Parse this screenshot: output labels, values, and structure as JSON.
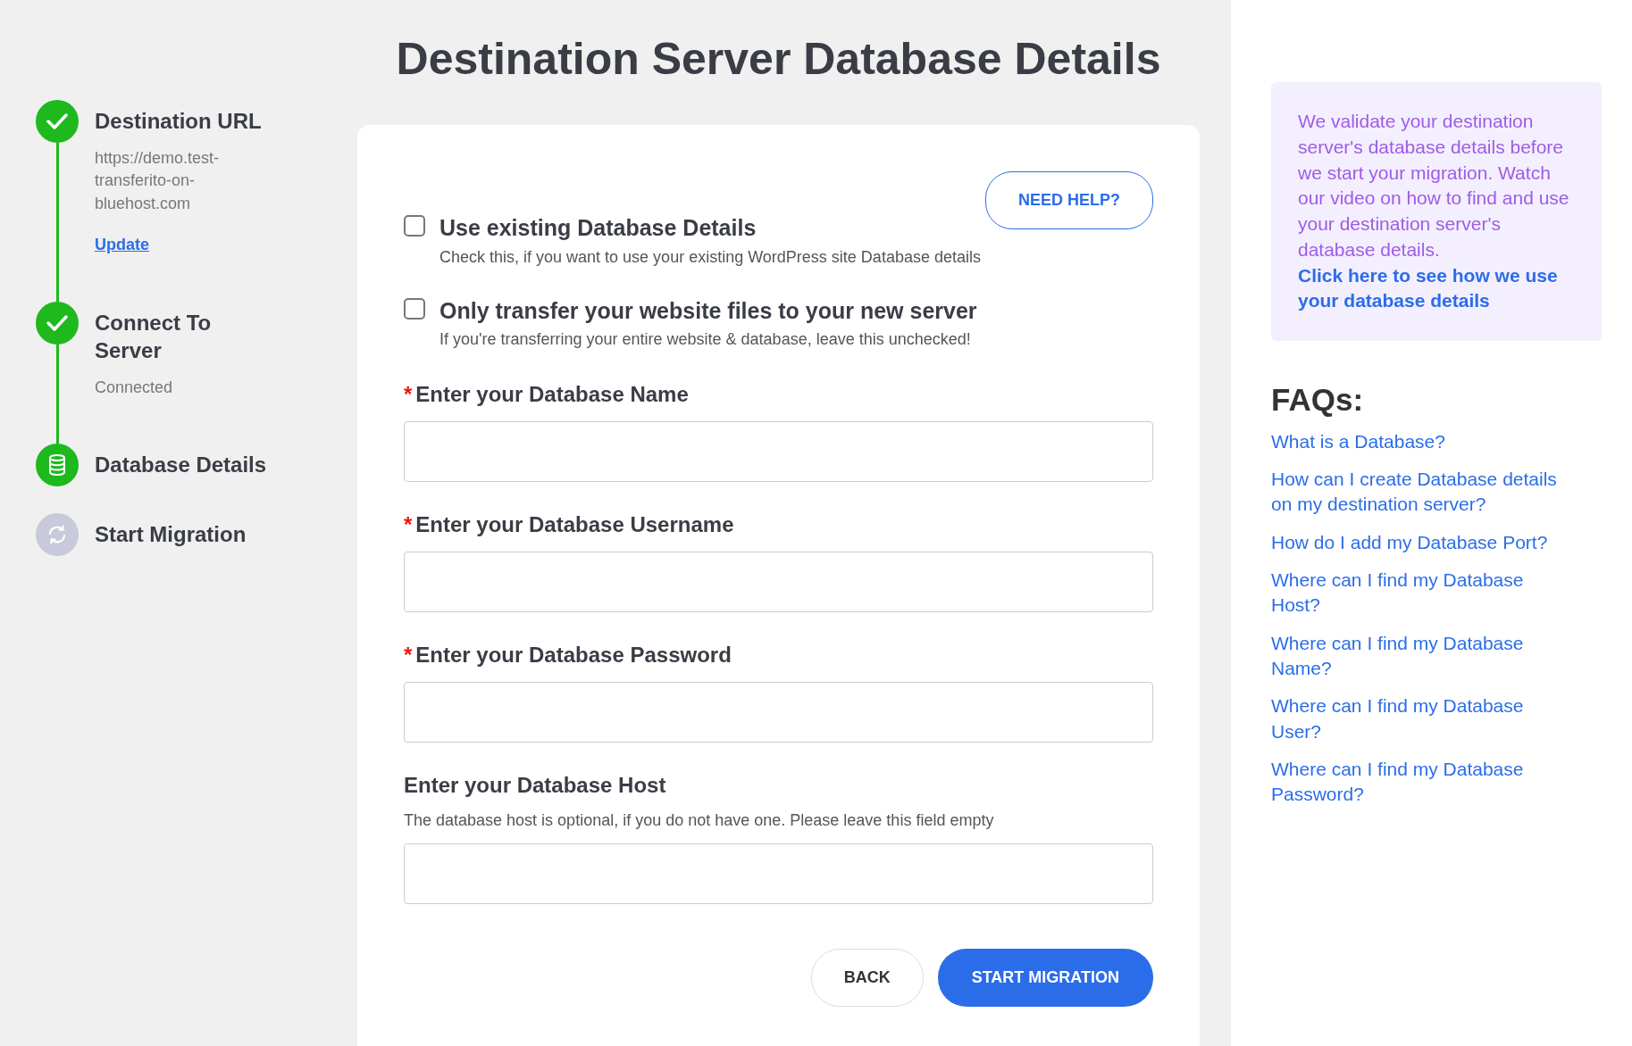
{
  "steps": [
    {
      "title": "Destination URL",
      "kind": "done",
      "completed": true,
      "details": [
        "https://demo.test-transferito-on-bluehost.com"
      ],
      "link": "Update"
    },
    {
      "title": "Connect To Server",
      "kind": "done",
      "completed": true,
      "details": [
        "Connected"
      ]
    },
    {
      "title": "Database Details",
      "kind": "database",
      "completed": false
    },
    {
      "title": "Start Migration",
      "kind": "pending",
      "completed": false
    }
  ],
  "heading": "Destination Server Database Details",
  "help_button": "NEED HELP?",
  "options": [
    {
      "label": "Use existing Database Details",
      "hint": "Check this, if you want to use your existing WordPress site Database details",
      "checked": false
    },
    {
      "label": "Only transfer your website files to your new server",
      "hint": "If you're transferring your entire website & database, leave this unchecked!",
      "checked": false
    }
  ],
  "fields": [
    {
      "label": "Enter your Database Name",
      "required": true
    },
    {
      "label": "Enter your Database Username",
      "required": true
    },
    {
      "label": "Enter your Database Password",
      "required": true
    },
    {
      "label": "Enter your Database Host",
      "required": false,
      "hint": "The database host is optional, if you do not have one. Please leave this field empty"
    }
  ],
  "required_mark": "*",
  "buttons": [
    {
      "label": "BACK",
      "kind": "secondary"
    },
    {
      "label": "START MIGRATION",
      "kind": "primary"
    }
  ],
  "info": {
    "text": "We validate your destination server's database details before we start your migration. Watch our video on how to find and use your destination server's database details.",
    "link": "Click here to see how we use your database details"
  },
  "faq": {
    "title": "FAQs:",
    "items": [
      "What is a Database?",
      "How can I create Database details on my destination server?",
      "How do I add my Database Port?",
      "Where can I find my Database Host?",
      "Where can I find my Database Name?",
      "Where can I find my Database User?",
      "Where can I find my Database Password?"
    ]
  }
}
